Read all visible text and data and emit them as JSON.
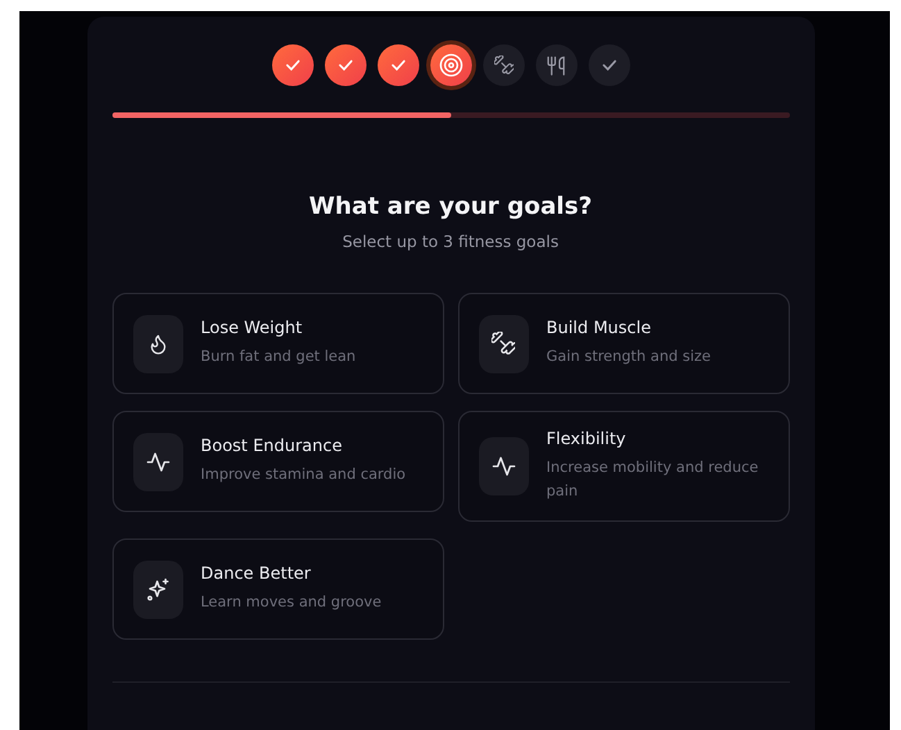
{
  "steps": [
    {
      "completed": true,
      "current": false
    },
    {
      "completed": true,
      "current": false
    },
    {
      "completed": true,
      "current": false
    },
    {
      "completed": false,
      "current": true
    },
    {
      "completed": false,
      "current": false
    },
    {
      "completed": false,
      "current": false
    },
    {
      "completed": false,
      "current": false
    }
  ],
  "progress": {
    "level": 0.5
  },
  "title": "What are your goals?",
  "subtitle": "Select up to 3 fitness goals",
  "goals": [
    {
      "title": "Lose Weight",
      "description": "Burn fat and get lean",
      "selected": false
    },
    {
      "title": "Build Muscle",
      "description": "Gain strength and size",
      "selected": false
    },
    {
      "title": "Boost Endurance",
      "description": "Improve stamina and cardio",
      "selected": false
    },
    {
      "title": "Flexibility",
      "description": "Increase mobility and reduce pain",
      "selected": false
    },
    {
      "title": "Dance Better",
      "description": "Learn moves and groove",
      "selected": false
    }
  ]
}
